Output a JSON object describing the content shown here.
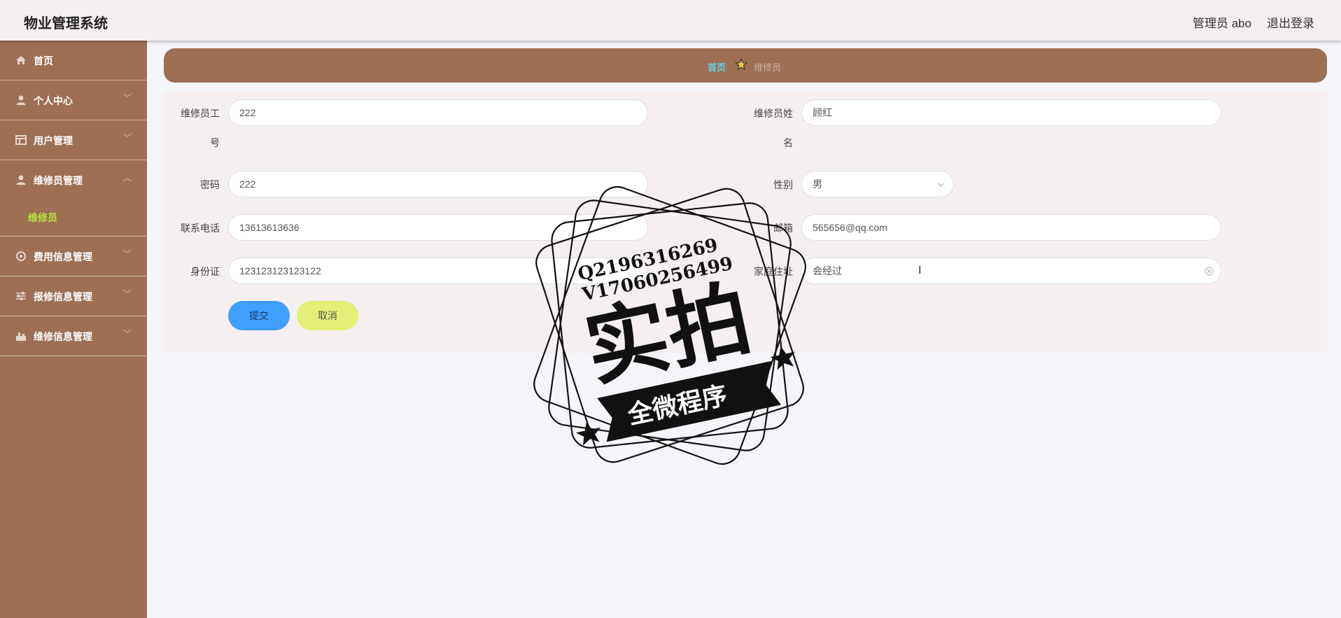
{
  "header": {
    "title": "物业管理系统",
    "user": "管理员 abo",
    "logout": "退出登录"
  },
  "sidebar": {
    "items": [
      {
        "label": "首页",
        "icon": "home-icon"
      },
      {
        "label": "个人中心",
        "icon": "user-icon"
      },
      {
        "label": "用户管理",
        "icon": "table-icon"
      },
      {
        "label": "维修员管理",
        "icon": "user-icon"
      },
      {
        "label": "费用信息管理",
        "icon": "settings-icon"
      },
      {
        "label": "报修信息管理",
        "icon": "sliders-icon"
      },
      {
        "label": "维修信息管理",
        "icon": "tools-icon"
      }
    ],
    "sub_item": "维修员"
  },
  "breadcrumb": {
    "home": "首页",
    "current": "维修员"
  },
  "form": {
    "staff_id": {
      "label_line1": "维修员工",
      "label_line2": "号",
      "value": "222"
    },
    "name": {
      "label_line1": "维修员姓",
      "label_line2": "名",
      "value": "顾红"
    },
    "password": {
      "label": "密码",
      "value": "222"
    },
    "gender": {
      "label": "性别",
      "value": "男"
    },
    "phone": {
      "label": "联系电话",
      "value": "13613613636"
    },
    "email": {
      "label": "邮箱",
      "value": "565656@qq.com"
    },
    "id_card": {
      "label": "身份证",
      "value": "123123123123122"
    },
    "address": {
      "label": "家庭住址",
      "value": "会经过"
    },
    "submit": "提交",
    "cancel": "取消"
  },
  "watermark": {
    "line1": "Q2196316269",
    "line2": "V17060256499",
    "big": "实拍",
    "ribbon": "全微程序"
  },
  "colors": {
    "sidebar": "#9e6f53",
    "accent": "#409eff",
    "cancel": "#e5ee76",
    "active": "#b6e33a"
  }
}
